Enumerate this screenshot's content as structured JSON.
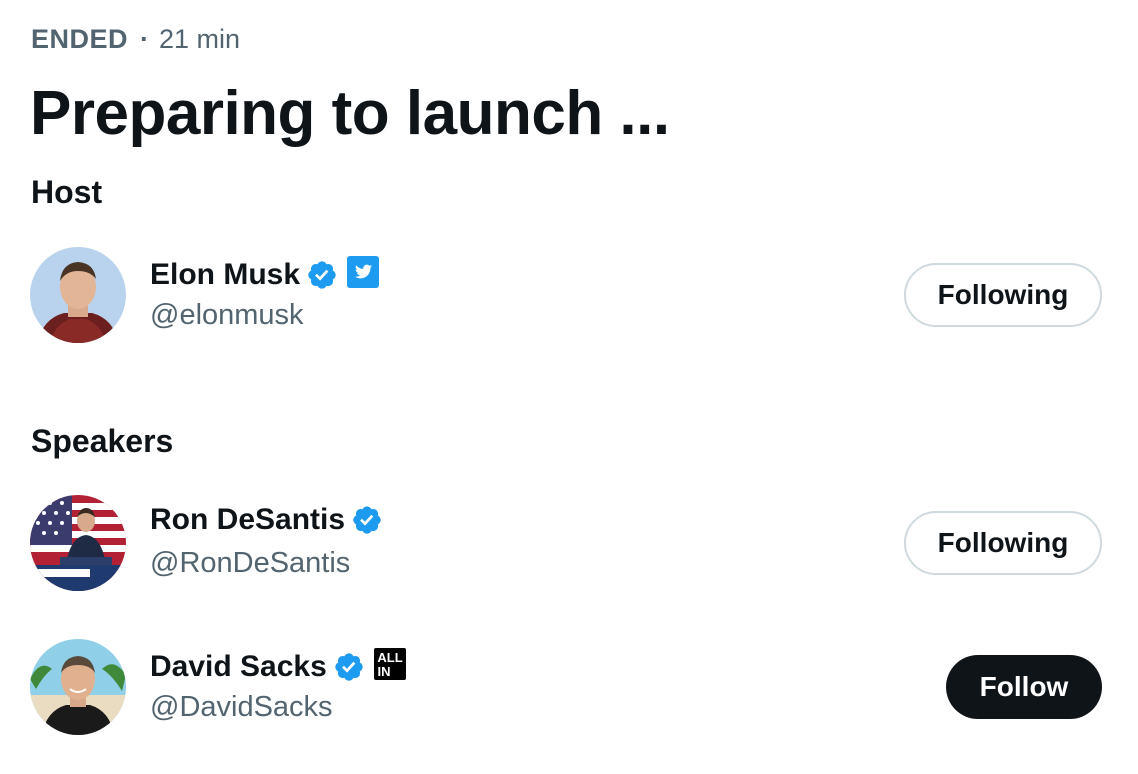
{
  "space": {
    "status": "ENDED",
    "separator": "·",
    "duration": "21 min",
    "title": "Preparing to launch ..."
  },
  "sections": {
    "host_heading": "Host",
    "speakers_heading": "Speakers"
  },
  "host": {
    "name": "Elon Musk",
    "handle": "@elonmusk",
    "verified": true,
    "affiliate_icon": "twitter-bird-icon",
    "button_label": "Following"
  },
  "speakers": [
    {
      "name": "Ron DeSantis",
      "handle": "@RonDeSantis",
      "verified": true,
      "button_label": "Following"
    },
    {
      "name": "David Sacks",
      "handle": "@DavidSacks",
      "verified": true,
      "affiliate_icon": "all-in-badge-icon",
      "affiliate_text": "ALL IN",
      "button_label": "Follow"
    }
  ],
  "colors": {
    "text": "#0f1419",
    "secondary_text": "#536471",
    "verified_blue": "#1d9bf0",
    "follow_button_bg": "#0f1419",
    "following_border": "#cfd9de"
  }
}
